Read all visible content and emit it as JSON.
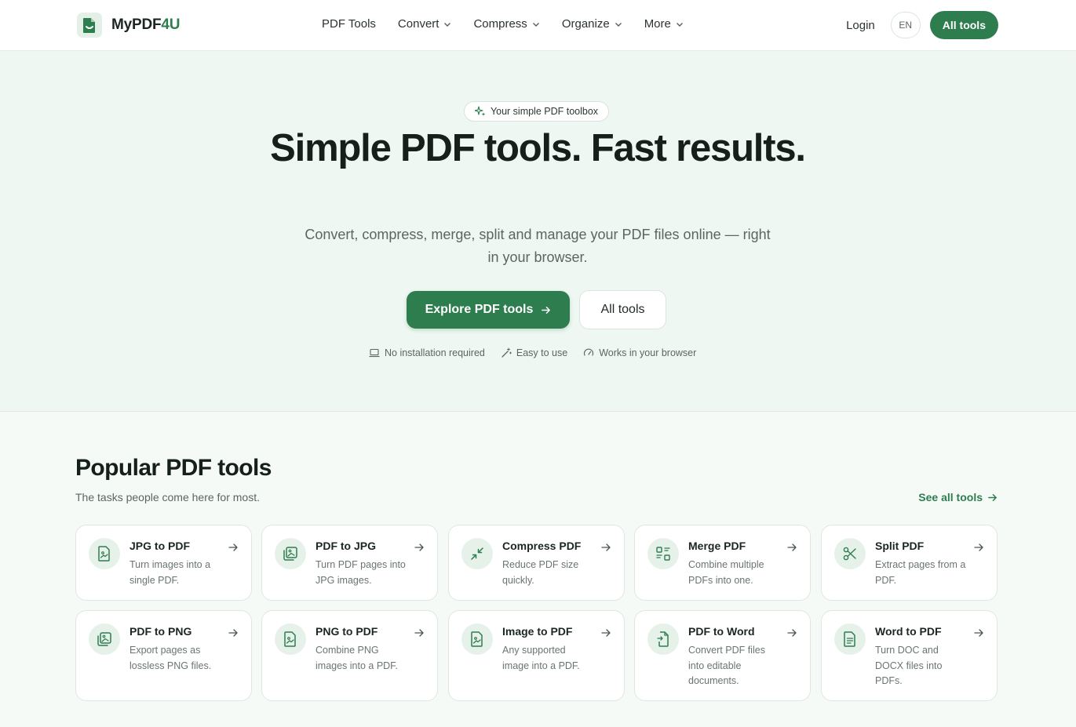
{
  "brand": {
    "name_main": "MyPDF",
    "name_accent": "4U",
    "accent_color": "#2e7d4f"
  },
  "nav": [
    {
      "label": "PDF Tools",
      "dropdown": false
    },
    {
      "label": "Convert",
      "dropdown": true
    },
    {
      "label": "Compress",
      "dropdown": true
    },
    {
      "label": "Organize",
      "dropdown": true
    },
    {
      "label": "More",
      "dropdown": true
    }
  ],
  "header": {
    "login": "Login",
    "lang": "EN",
    "all_tools": "All tools"
  },
  "hero": {
    "pill": "Your simple PDF toolbox",
    "title": "Simple PDF tools. Fast results.",
    "subtitle": "Convert, compress, merge, split and manage your PDF files online — right in your browser.",
    "cta_primary": "Explore PDF tools",
    "cta_secondary": "All tools",
    "features": [
      "No installation required",
      "Easy to use",
      "Works in your browser"
    ]
  },
  "popular": {
    "title": "Popular PDF tools",
    "subtitle": "The tasks people come here for most.",
    "see_all": "See all tools",
    "cards": [
      {
        "title": "JPG to PDF",
        "desc": "Turn images into a single PDF.",
        "icon": "file-image-icon"
      },
      {
        "title": "PDF to JPG",
        "desc": "Turn PDF pages into JPG images.",
        "icon": "images-icon"
      },
      {
        "title": "Compress PDF",
        "desc": "Reduce PDF size quickly.",
        "icon": "compress-icon"
      },
      {
        "title": "Merge PDF",
        "desc": "Combine multiple PDFs into one.",
        "icon": "merge-icon"
      },
      {
        "title": "Split PDF",
        "desc": "Extract pages from a PDF.",
        "icon": "scissors-icon"
      },
      {
        "title": "PDF to PNG",
        "desc": "Export pages as lossless PNG files.",
        "icon": "images-icon"
      },
      {
        "title": "PNG to PDF",
        "desc": "Combine PNG images into a PDF.",
        "icon": "file-image-icon"
      },
      {
        "title": "Image to PDF",
        "desc": "Any supported image into a PDF.",
        "icon": "file-image-icon"
      },
      {
        "title": "PDF to Word",
        "desc": "Convert PDF files into editable documents.",
        "icon": "file-convert-icon"
      },
      {
        "title": "Word to PDF",
        "desc": "Turn DOC and DOCX files into PDFs.",
        "icon": "file-text-icon"
      }
    ]
  }
}
